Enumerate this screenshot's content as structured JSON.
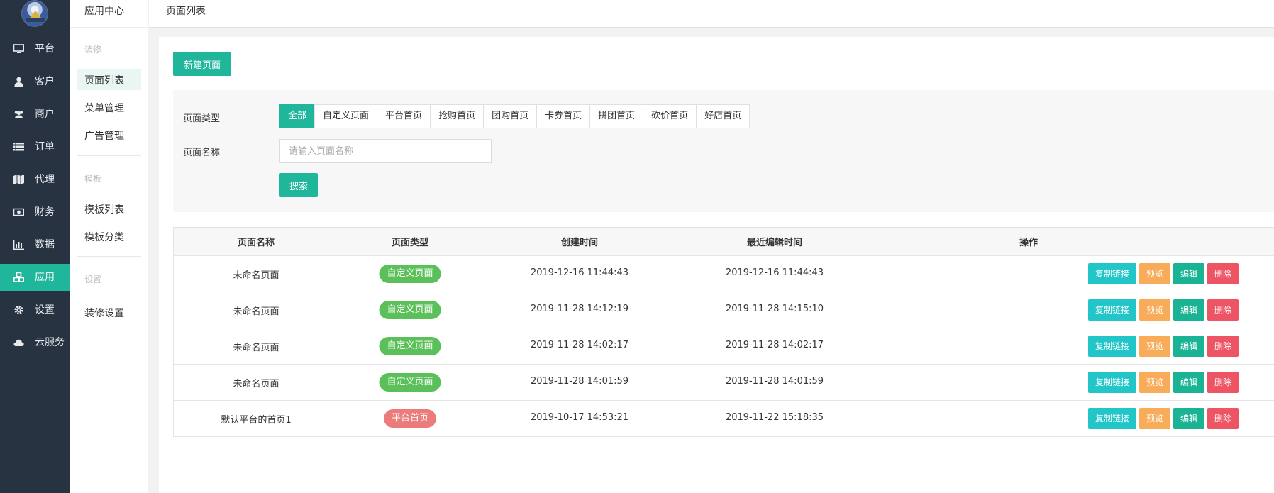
{
  "sidebar": {
    "items": [
      {
        "label": "平台",
        "icon": "monitor-icon"
      },
      {
        "label": "客户",
        "icon": "user-icon"
      },
      {
        "label": "商户",
        "icon": "users-icon"
      },
      {
        "label": "订单",
        "icon": "list-icon"
      },
      {
        "label": "代理",
        "icon": "map-icon"
      },
      {
        "label": "财务",
        "icon": "money-icon"
      },
      {
        "label": "数据",
        "icon": "bar-chart-icon"
      },
      {
        "label": "应用",
        "icon": "cubes-icon",
        "active": true
      },
      {
        "label": "设置",
        "icon": "gear-icon"
      },
      {
        "label": "云服务",
        "icon": "cloud-icon"
      }
    ]
  },
  "subnav": {
    "title": "应用中心",
    "groups": [
      {
        "title": "装修",
        "items": [
          "页面列表",
          "菜单管理",
          "广告管理"
        ]
      },
      {
        "title": "模板",
        "items": [
          "模板列表",
          "模板分类"
        ]
      },
      {
        "title": "设置",
        "items": [
          "装修设置"
        ]
      }
    ]
  },
  "breadcrumb": "页面列表",
  "toolbar": {
    "new_label": "新建页面"
  },
  "filters": {
    "type_label": "页面类型",
    "types": [
      "全部",
      "自定义页面",
      "平台首页",
      "抢购首页",
      "团购首页",
      "卡券首页",
      "拼团首页",
      "砍价首页",
      "好店首页"
    ],
    "active_type": "全部",
    "name_label": "页面名称",
    "name_placeholder": "请输入页面名称",
    "name_value": "",
    "search_label": "搜索"
  },
  "table": {
    "headers": [
      "页面名称",
      "页面类型",
      "创建时间",
      "最近编辑时间",
      "操作"
    ],
    "rows": [
      {
        "name": "未命名页面",
        "type": "自定义页面",
        "type_color": "#5cc05a",
        "created": "2019-12-16 11:44:43",
        "edited": "2019-12-16 11:44:43"
      },
      {
        "name": "未命名页面",
        "type": "自定义页面",
        "type_color": "#5cc05a",
        "created": "2019-11-28 14:12:19",
        "edited": "2019-11-28 14:15:10"
      },
      {
        "name": "未命名页面",
        "type": "自定义页面",
        "type_color": "#5cc05a",
        "created": "2019-11-28 14:02:17",
        "edited": "2019-11-28 14:02:17"
      },
      {
        "name": "未命名页面",
        "type": "自定义页面",
        "type_color": "#5cc05a",
        "created": "2019-11-28 14:01:59",
        "edited": "2019-11-28 14:01:59"
      },
      {
        "name": "默认平台的首页1",
        "type": "平台首页",
        "type_color": "#ec7b7b",
        "created": "2019-10-17 14:53:21",
        "edited": "2019-11-22 15:18:35"
      }
    ],
    "actions": {
      "copy": "复制链接",
      "preview": "预览",
      "edit": "编辑",
      "delete": "删除"
    }
  },
  "colors": {
    "sidebar_bg": "#273341",
    "accent": "#1fb69c",
    "copy": "#23c6c8",
    "preview": "#f8ac59",
    "edit": "#1ab394",
    "delete": "#ed5565"
  }
}
